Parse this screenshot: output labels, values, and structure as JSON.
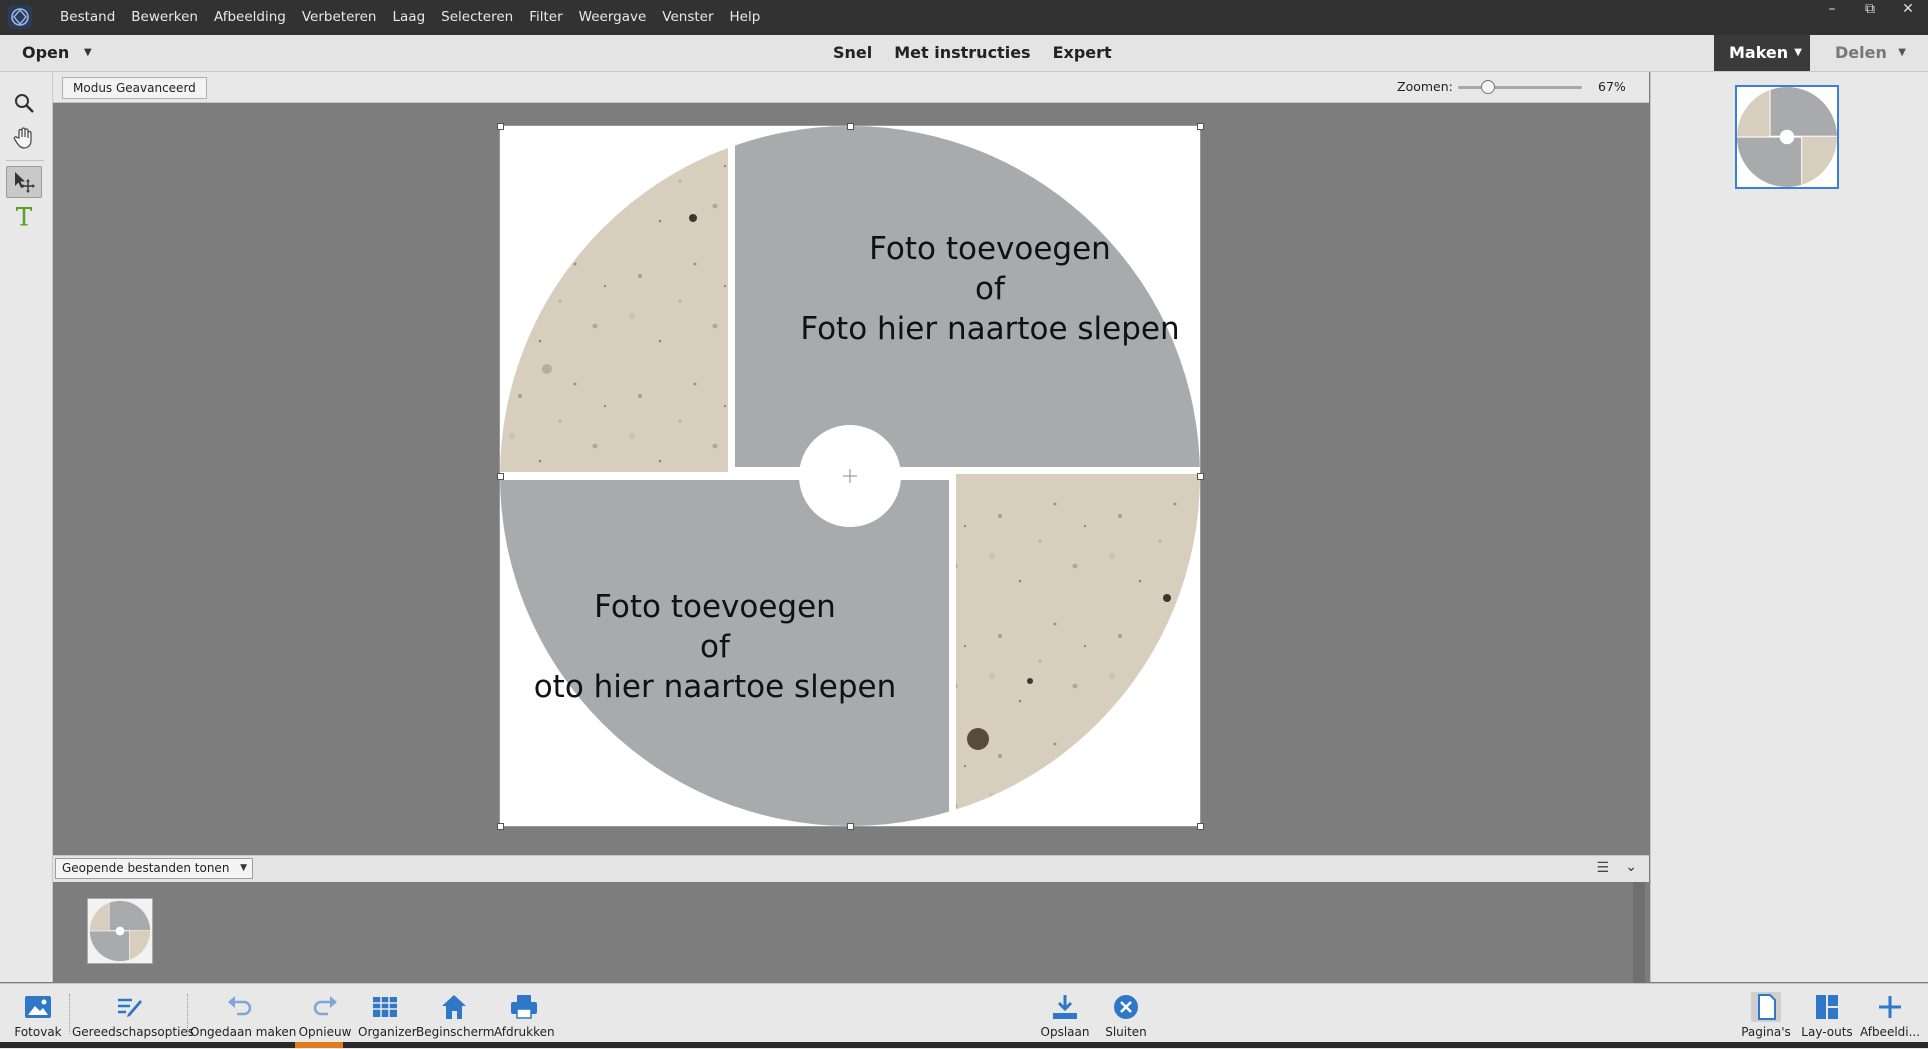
{
  "menubar": {
    "items": [
      "Bestand",
      "Bewerken",
      "Afbeelding",
      "Verbeteren",
      "Laag",
      "Selecteren",
      "Filter",
      "Weergave",
      "Venster",
      "Help"
    ]
  },
  "modebar": {
    "open_label": "Open",
    "tabs": [
      "Snel",
      "Met instructies",
      "Expert"
    ],
    "maken_label": "Maken",
    "delen_label": "Delen"
  },
  "options": {
    "mode_badge": "Modus Geavanceerd",
    "zoom_label": "Zoomen:",
    "zoom_value": "67%",
    "zoom_fraction": 0.24
  },
  "canvas": {
    "slot_top": {
      "line1": "Foto toevoegen",
      "line2": "of",
      "line3": "Foto hier naartoe slepen"
    },
    "slot_bottom": {
      "line1": "Foto toevoegen",
      "line2": "of",
      "line3": "oto hier naartoe slepen"
    }
  },
  "photo_bin": {
    "select_label": "Geopende bestanden tonen"
  },
  "bottom_left": [
    {
      "label": "Fotovak",
      "icon": "photo-bin-icon"
    },
    {
      "label": "Gereedschapsopties",
      "icon": "tool-options-icon"
    },
    {
      "label": "Ongedaan maken",
      "icon": "undo-icon"
    },
    {
      "label": "Opnieuw",
      "icon": "redo-icon"
    },
    {
      "label": "Organizer",
      "icon": "organizer-icon"
    },
    {
      "label": "Beginscherm",
      "icon": "home-icon"
    },
    {
      "label": "Afdrukken",
      "icon": "print-icon"
    }
  ],
  "bottom_center": [
    {
      "label": "Opslaan",
      "icon": "save-icon"
    },
    {
      "label": "Sluiten",
      "icon": "close-circle-icon"
    }
  ],
  "bottom_right": [
    {
      "label": "Pagina's",
      "icon": "pages-icon"
    },
    {
      "label": "Lay-outs",
      "icon": "layouts-icon"
    },
    {
      "label": "Afbeeldi...",
      "icon": "add-image-icon"
    }
  ],
  "colors": {
    "accent": "#3b7fd6",
    "placeholder_gray": "#a9aaac",
    "stone_texture": "#d6ccbb"
  }
}
